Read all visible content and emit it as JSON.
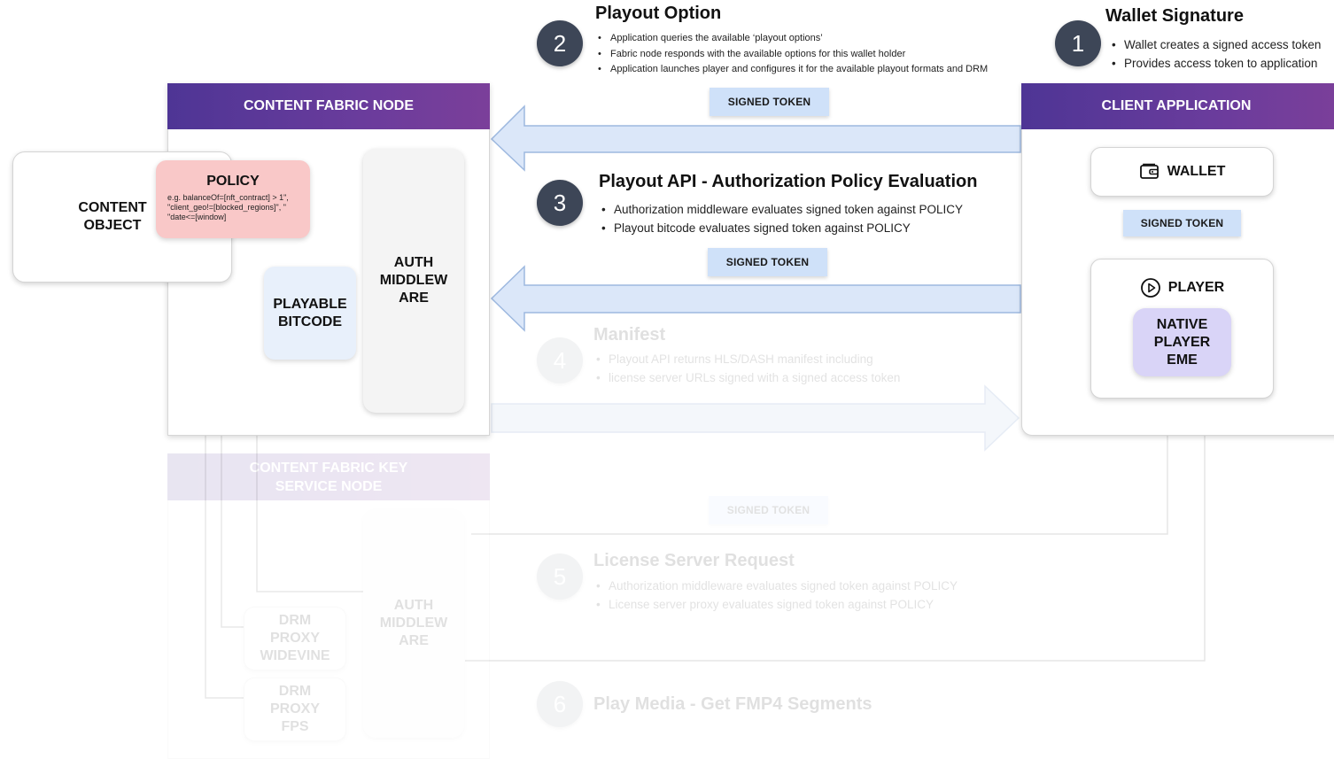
{
  "colors": {
    "header_purple": "#5b3796",
    "token_blue": "#cfe1f9",
    "arrow_fill": "#dbe7f9",
    "arrow_stroke": "#9db8df",
    "step_circle": "#3d4657",
    "policy_pink": "#f9c8c8",
    "playable_blue": "#e8f0fb",
    "native_lavender": "#d9d4f7"
  },
  "content_fabric_node": {
    "title": "CONTENT FABRIC NODE",
    "content_object": "CONTENT OBJECT",
    "policy": {
      "title": "POLICY",
      "example": "e.g. balanceOf=[nft_contract] > 1\",\n\"client_geo!=[blocked_regions]\", \"\n\"date<=[window]"
    },
    "playable_bitcode": "PLAYABLE BITCODE",
    "auth_middleware": "AUTH MIDDLEW ARE"
  },
  "client_application": {
    "title": "CLIENT APPLICATION",
    "wallet": {
      "label": "WALLET",
      "icon": "wallet-icon"
    },
    "signed_token": "SIGNED TOKEN",
    "player": {
      "label": "PLAYER",
      "icon": "play-circle-icon",
      "native": "NATIVE PLAYER EME"
    }
  },
  "steps": {
    "step1": {
      "number": "1",
      "title": "Wallet Signature",
      "bullets": [
        "Wallet creates a signed access token",
        "Provides access token to application"
      ]
    },
    "step2": {
      "number": "2",
      "title": "Playout Option",
      "bullets": [
        "Application queries the available ‘playout options’",
        "Fabric node responds with the available options for this wallet holder",
        "Application launches player and configures it for the available playout formats and DRM"
      ],
      "token": "SIGNED TOKEN"
    },
    "step3": {
      "number": "3",
      "title": "Playout API - Authorization Policy Evaluation",
      "bullets": [
        "Authorization middleware evaluates signed token against POLICY",
        "Playout bitcode evaluates signed token against POLICY"
      ],
      "token": "SIGNED TOKEN"
    },
    "step4": {
      "number": "4",
      "title": "Manifest",
      "bullets": [
        "Playout API returns HLS/DASH manifest including",
        "license server URLs signed with a signed access token"
      ]
    },
    "step5": {
      "number": "5",
      "title": "License Server Request",
      "bullets": [
        "Authorization middleware evaluates signed token against POLICY",
        "License server proxy evaluates signed token against POLICY"
      ],
      "token": "SIGNED TOKEN"
    },
    "step6": {
      "number": "6",
      "title": "Play Media - Get FMP4 Segments"
    }
  },
  "key_service_node": {
    "title": "CONTENT FABRIC KEY SERVICE NODE",
    "drm_widevine": "DRM PROXY WIDEVINE",
    "drm_fps": "DRM PROXY FPS",
    "auth_middleware": "AUTH MIDDLEW ARE"
  }
}
